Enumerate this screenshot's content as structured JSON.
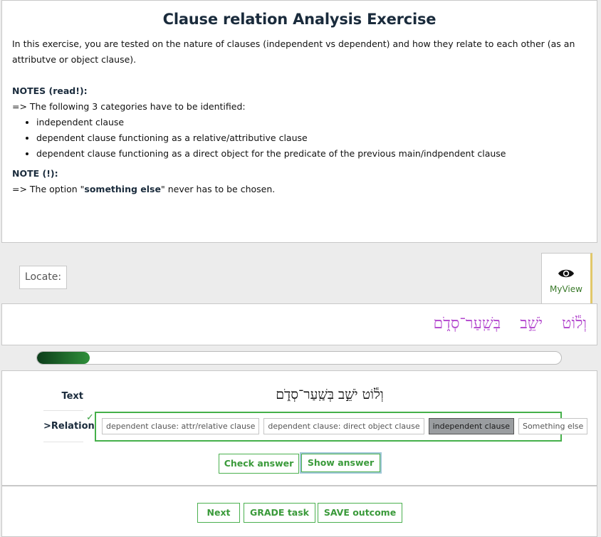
{
  "intro": {
    "title": "Clause relation Analysis Exercise",
    "description": "In this exercise, you are tested on the nature of clauses (independent vs dependent) and how they relate to each other (as an attributve or object clause).",
    "notes_heading": "NOTES (read!):",
    "notes_lead": "=> The following 3 categories have to be identified:",
    "categories": [
      "independent clause",
      "dependent clause functioning as a relative/attributive clause",
      "dependent clause functioning as a direct object for the predicate of the previous main/indpendent clause"
    ],
    "note2_heading": "NOTE (!):",
    "note2_pre": "=> The option  \"",
    "note2_bold": "something else",
    "note2_post": "\" never has to be chosen."
  },
  "locate_label": "Locate:",
  "myview_label": "MyView",
  "text_words": [
    "וְל֕וֹט",
    "יֹשֵׁ֣ב",
    "בְּשַֽׁעַר־סְדֹ֑ם"
  ],
  "progress": 0.1,
  "exercise": {
    "row_text_label": "Text",
    "row_relation_label": ">Relation",
    "check_mark": "✓",
    "hebrew_line": "וְל֕וֹט יֹשֵׁ֣ב בְּשַֽׁעַר־סְדֹ֑ם",
    "options": [
      "dependent clause: attr/relative clause",
      "dependent clause: direct object clause",
      "independent clause",
      "Something else"
    ],
    "selected_option": "independent clause",
    "check_answer": "Check answer",
    "show_answer": "Show answer"
  },
  "footer": {
    "next": "Next",
    "grade": "GRADE task",
    "save": "SAVE outcome"
  },
  "colors": {
    "accent_green": "#3a9a3a",
    "hebrew_purple": "#b64fd0",
    "title_navy": "#1a2b3c"
  },
  "icons": {
    "myview": "eye-icon"
  }
}
